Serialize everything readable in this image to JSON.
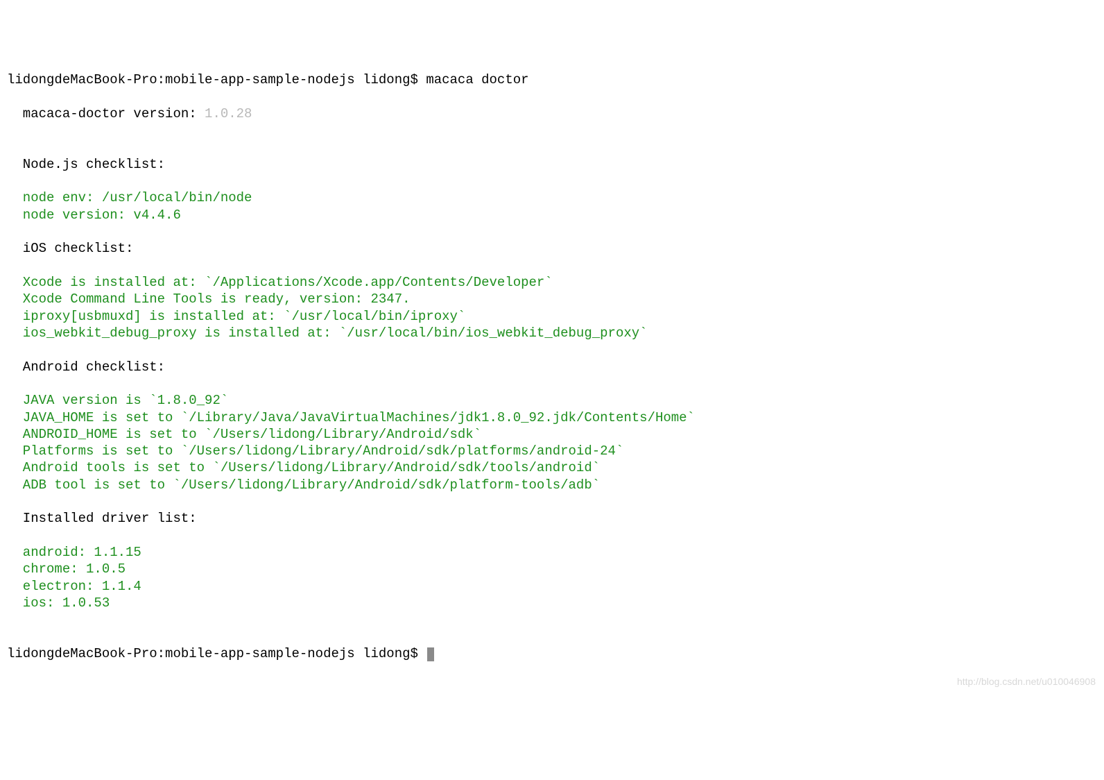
{
  "prompt1": "lidongdeMacBook-Pro:mobile-app-sample-nodejs lidong$ ",
  "command": "macaca doctor",
  "version_label": "  macaca-doctor version: ",
  "version_value": "1.0.28",
  "node_header": "  Node.js checklist:",
  "node_env": "  node env: /usr/local/bin/node",
  "node_version": "  node version: v4.4.6",
  "ios_header": "  iOS checklist:",
  "ios_xcode": "  Xcode is installed at: `/Applications/Xcode.app/Contents/Developer`",
  "ios_clt": "  Xcode Command Line Tools is ready, version: 2347.",
  "ios_iproxy": "  iproxy[usbmuxd] is installed at: `/usr/local/bin/iproxy`",
  "ios_webkit": "  ios_webkit_debug_proxy is installed at: `/usr/local/bin/ios_webkit_debug_proxy`",
  "android_header": "  Android checklist:",
  "android_java": "  JAVA version is `1.8.0_92`",
  "android_javahome": "  JAVA_HOME is set to `/Library/Java/JavaVirtualMachines/jdk1.8.0_92.jdk/Contents/Home`",
  "android_home": "  ANDROID_HOME is set to `/Users/lidong/Library/Android/sdk`",
  "android_platforms": "  Platforms is set to `/Users/lidong/Library/Android/sdk/platforms/android-24`",
  "android_tools": "  Android tools is set to `/Users/lidong/Library/Android/sdk/tools/android`",
  "android_adb": "  ADB tool is set to `/Users/lidong/Library/Android/sdk/platform-tools/adb`",
  "drivers_header": "  Installed driver list:",
  "driver_android": "  android: 1.1.15",
  "driver_chrome": "  chrome: 1.0.5",
  "driver_electron": "  electron: 1.1.4",
  "driver_ios": "  ios: 1.0.53",
  "prompt2": "lidongdeMacBook-Pro:mobile-app-sample-nodejs lidong$ ",
  "watermark": "http://blog.csdn.net/u010046908"
}
